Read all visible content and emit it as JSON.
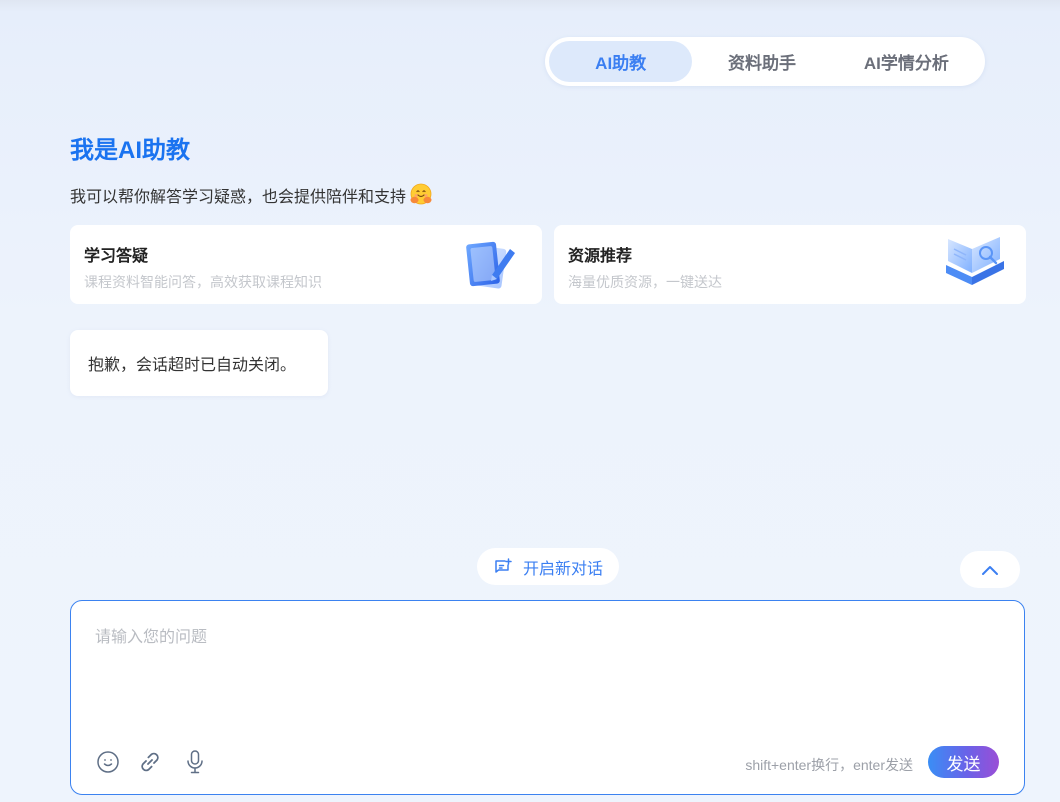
{
  "tabs": [
    {
      "label": "AI助教",
      "active": true
    },
    {
      "label": "资料助手",
      "active": false
    },
    {
      "label": "AI学情分析",
      "active": false
    }
  ],
  "hero": {
    "title": "我是AI助教",
    "subtitle": "我可以帮你解答学习疑惑，也会提供陪伴和支持"
  },
  "cards": [
    {
      "title": "学习答疑",
      "desc": "课程资料智能问答，高效获取课程知识",
      "icon": "notebook-pen-icon"
    },
    {
      "title": "资源推荐",
      "desc": "海量优质资源，一键送达",
      "icon": "open-book-icon"
    }
  ],
  "message": {
    "text": "抱歉，会话超时已自动关闭。"
  },
  "new_chat": {
    "label": "开启新对话"
  },
  "input": {
    "placeholder": "请输入您的问题",
    "value": "",
    "hint": "shift+enter换行，enter发送",
    "send_label": "发送"
  },
  "colors": {
    "accent": "#3b7ff2",
    "title": "#1a73f0",
    "active_tab_bg": "#dde9fb",
    "input_border": "#3b82f0"
  }
}
